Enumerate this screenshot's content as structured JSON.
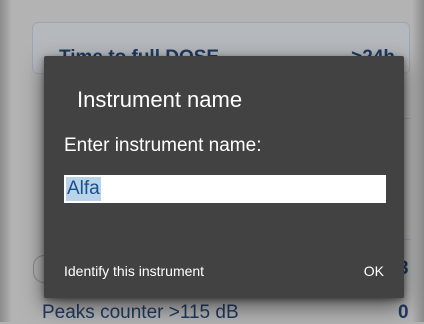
{
  "background": {
    "card_label": "Time to full DOSE",
    "card_value": ">24h",
    "side_value_1": "3",
    "bottom_label": "Peaks counter >115 dB",
    "bottom_value": "0"
  },
  "dialog": {
    "title": "Instrument name",
    "prompt": "Enter instrument name:",
    "input_value": "Alfa",
    "identify_label": "Identify this instrument",
    "ok_label": "OK"
  },
  "colors": {
    "dialog_bg": "#424242",
    "text_accent": "#1a4f8b",
    "selection": "#b9d4ea"
  }
}
